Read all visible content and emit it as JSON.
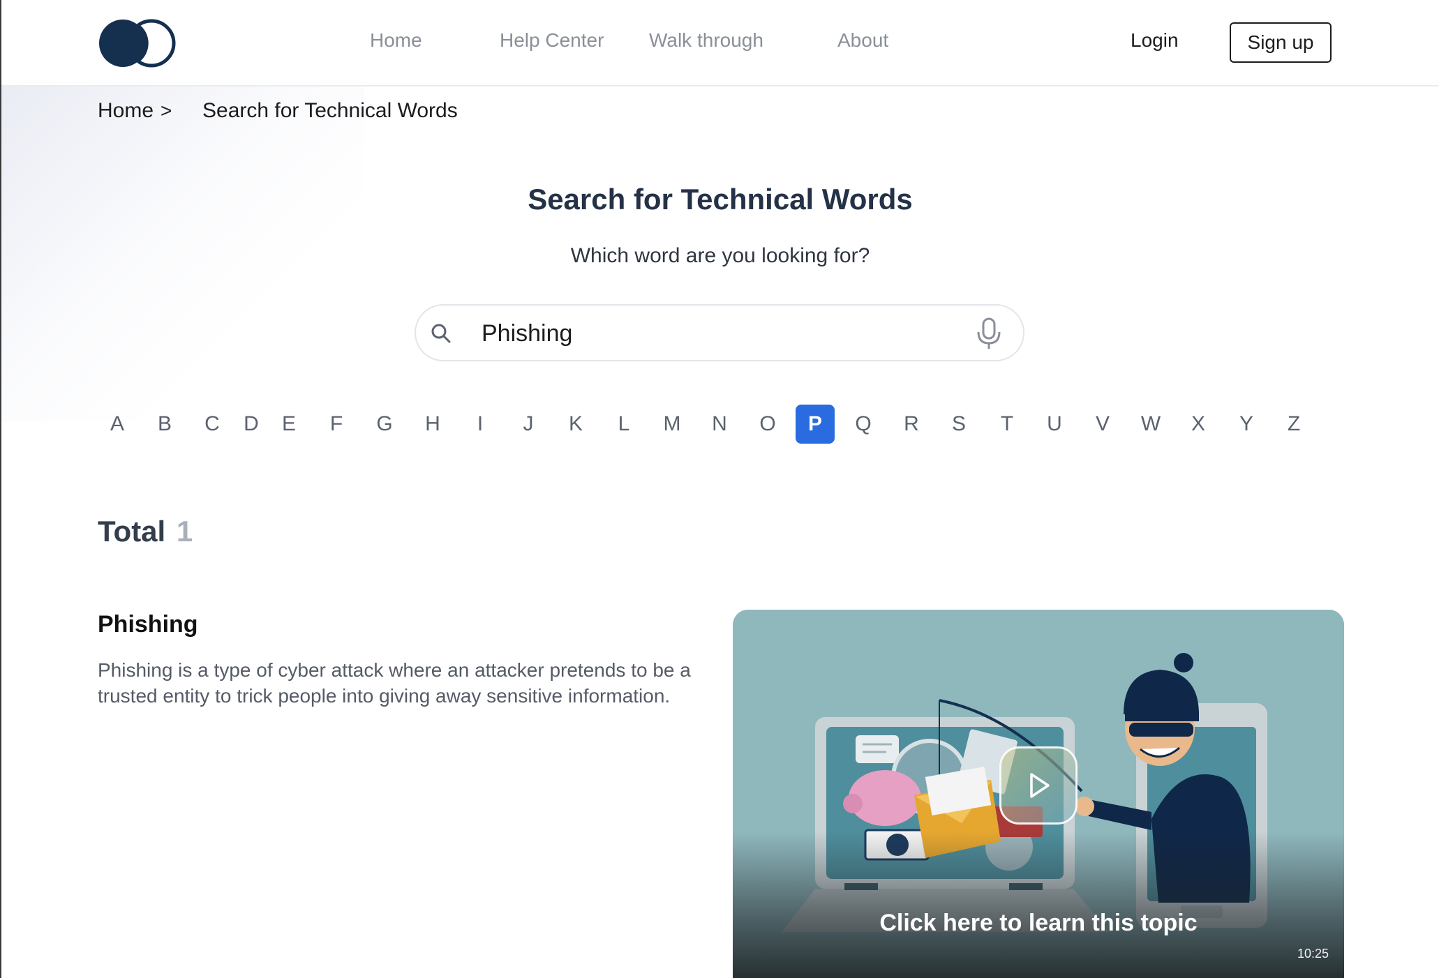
{
  "nav": {
    "items": [
      {
        "label": "Home"
      },
      {
        "label": "Help Center"
      },
      {
        "label": "Walk through"
      },
      {
        "label": "About"
      }
    ],
    "login_label": "Login",
    "signup_label": "Sign up"
  },
  "breadcrumb": {
    "home": "Home",
    "separator": ">",
    "current": "Search for Technical Words"
  },
  "page": {
    "title": "Search for Technical Words",
    "subtitle": "Which word are you looking for?"
  },
  "search": {
    "value": "Phishing",
    "icon": "search-icon",
    "mic_icon": "microphone-icon"
  },
  "alphabet": {
    "letters": [
      "A",
      "B",
      "C",
      "D",
      "E",
      "F",
      "G",
      "H",
      "I",
      "J",
      "K",
      "L",
      "M",
      "N",
      "O",
      "P",
      "Q",
      "R",
      "S",
      "T",
      "U",
      "V",
      "W",
      "X",
      "Y",
      "Z"
    ],
    "selected": "P",
    "accent_color": "#2a6ce0"
  },
  "results": {
    "total_label": "Total",
    "total_count": "1",
    "items": [
      {
        "title": "Phishing",
        "description": "Phishing is a type of cyber attack where an attacker pretends to be a trusted entity to trick people into giving away sensitive information.",
        "video": {
          "caption": "Click here to learn this topic",
          "duration": "10:25",
          "play_icon": "play-icon"
        }
      }
    ]
  },
  "colors": {
    "brand_navy": "#152f4f",
    "title_text": "#243146",
    "video_bg": "#8fb8bd"
  }
}
